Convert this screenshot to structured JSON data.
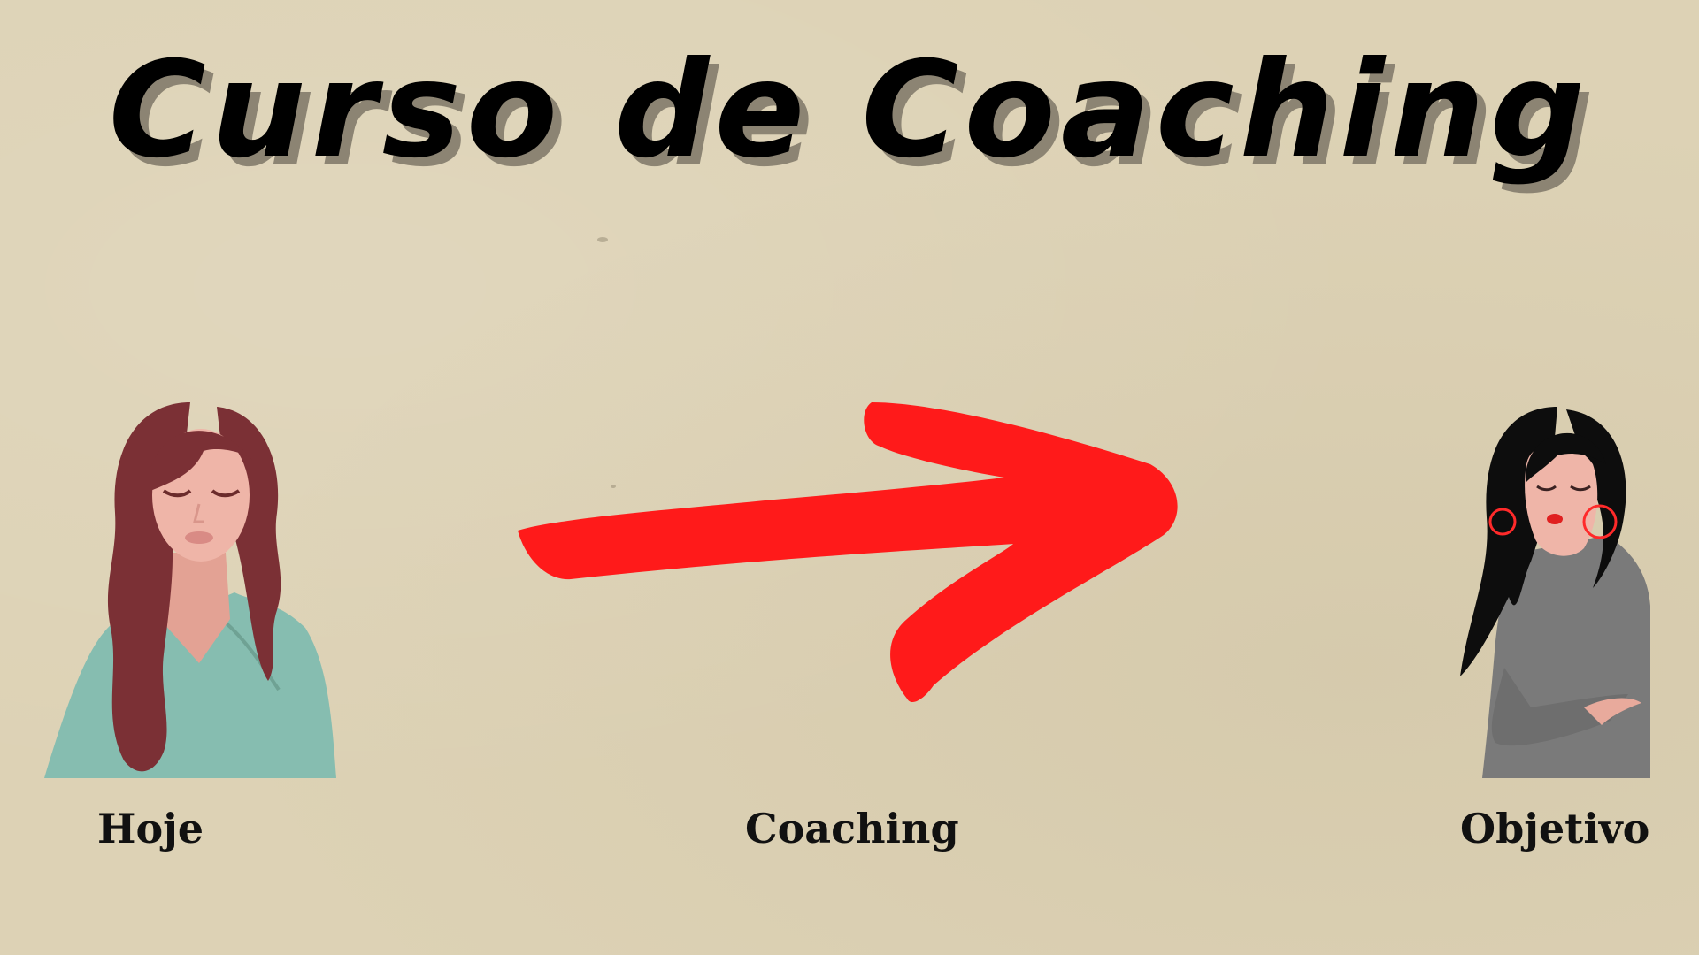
{
  "title": "Curso de Coaching",
  "labels": {
    "left": "Hoje",
    "middle": "Coaching",
    "right": "Objetivo"
  },
  "figures": {
    "left": "woman-with-wavy-hair-illustration",
    "middle": "red-arrow",
    "right": "woman-with-black-hair-illustration"
  },
  "colors": {
    "background": "#ddd2b5",
    "title": "#000000",
    "arrow": "#ff1a1a",
    "left_hair": "#7b3035",
    "left_shirt": "#86bdb0",
    "skin": "#e8aa9c",
    "right_hair": "#0d0d0d",
    "right_shirt": "#7a7a7a",
    "earring": "#ff2a2a"
  }
}
